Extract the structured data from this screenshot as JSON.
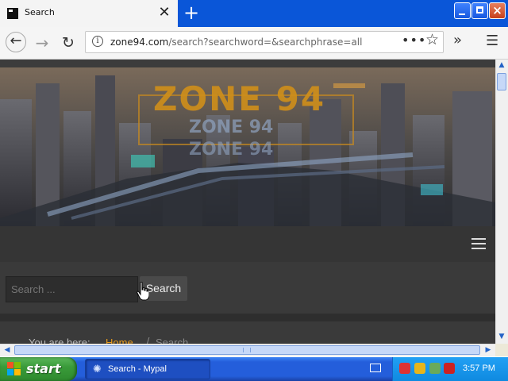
{
  "browser": {
    "tab_title": "Search",
    "tab_close": "✕",
    "new_tab": "+",
    "url_domain": "zone94.com",
    "url_rest": "/search?searchword=&searchphrase=all",
    "info": "i",
    "more": "•••",
    "star": "☆",
    "overflow": "»",
    "menu": "☰",
    "back": "←",
    "forward": "→",
    "reload": "↻"
  },
  "site": {
    "logo_text": "ZONE 94",
    "logo_echo_1": "ZONE 94",
    "logo_echo_2": "ZONE 94",
    "search_placeholder": "Search ...",
    "search_button": "Search",
    "breadcrumb_label": "You are here:",
    "breadcrumb_home": "Home",
    "breadcrumb_sep": "/",
    "breadcrumb_current": "Search"
  },
  "taskbar": {
    "start_label": "start",
    "task_label": "Search - Mypal",
    "clock": "3:57 PM"
  },
  "colors": {
    "accent_orange": "#e59a1c",
    "page_bg": "#3c3c3c",
    "xp_blue": "#245edb",
    "xp_green": "#3a9b3a"
  }
}
